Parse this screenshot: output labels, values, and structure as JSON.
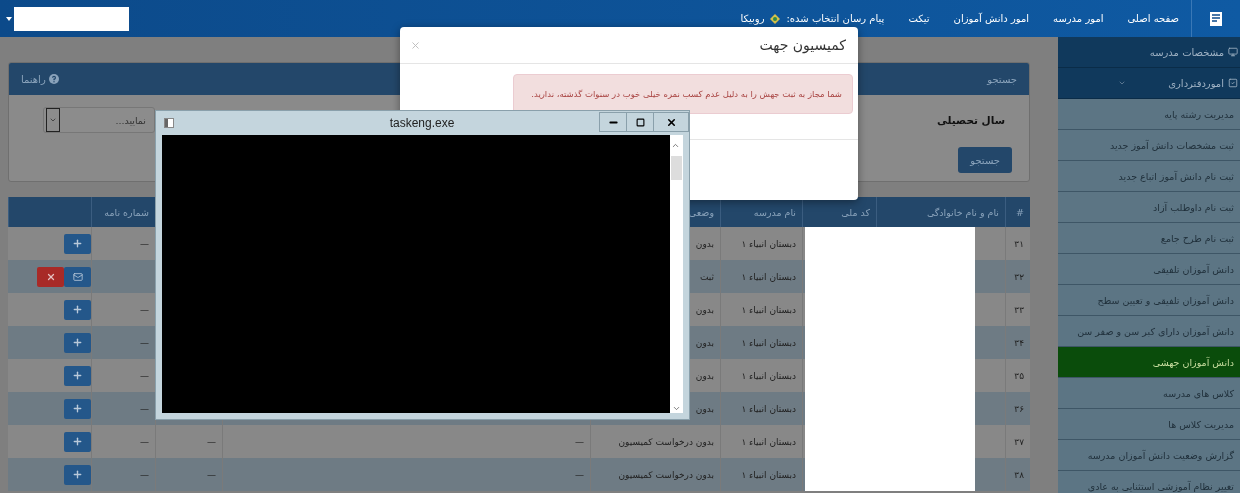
{
  "navbar": {
    "menu": [
      {
        "label": "صفحه اصلی"
      },
      {
        "label": "امور مدرسه"
      },
      {
        "label": "امور دانش آموزان"
      },
      {
        "label": "تیکت"
      }
    ],
    "messenger_label": "پیام رسان انتخاب شده:",
    "messenger_name": "روبیکا"
  },
  "sidebar": {
    "sections": [
      {
        "label": "مشخصات مدرسه",
        "expanded": false
      },
      {
        "label": "اموردفترداری",
        "expanded": true,
        "children": [
          {
            "label": "مدیریت رشته پایه",
            "selected": false
          },
          {
            "label": "ثبت مشخصات دانش آموز جدید",
            "selected": false
          },
          {
            "label": "ثبت نام دانش آموز اتباع جدید",
            "selected": false
          },
          {
            "label": "ثبت نام داوطلب آزاد",
            "selected": false
          },
          {
            "label": "ثبت نام طرح جامع",
            "selected": false
          },
          {
            "label": "دانش آموزان تلفیقی",
            "selected": false
          },
          {
            "label": "دانش آموزان تلفیقی و تعیین سطح",
            "selected": false
          },
          {
            "label": "دانش آموزان دارای کبر سن و صفر سن",
            "selected": false
          },
          {
            "label": "دانش آموزان جهشی",
            "selected": true
          },
          {
            "label": "کلاس های مدرسه",
            "selected": false
          },
          {
            "label": "مدیریت کلاس ها",
            "selected": false
          },
          {
            "label": "گزارش وضعیت دانش آموزان مدرسه",
            "selected": false
          },
          {
            "label": "تغییر نظام آموزشی استثنایی به عادی",
            "selected": false
          }
        ]
      }
    ]
  },
  "search_panel": {
    "title": "جستجو",
    "help": "راهنما",
    "year_label": "سال تحصیلی",
    "year_select": "نمایید...",
    "button": "جستجو"
  },
  "table": {
    "columns": {
      "number": "#",
      "name": "نام و نام خانوادگی",
      "national_code": "کد ملی",
      "school": "نام مدرسه",
      "status": "وضعی",
      "letter_number": "شماره نامه"
    },
    "rows": [
      {
        "number": "۳۱",
        "school": "دبستان انبیاء ۱",
        "status": "بدون",
        "letter_number": "—",
        "kind": "add"
      },
      {
        "number": "۳۲",
        "school": "دبستان انبیاء ۱",
        "status": "ثبت",
        "kind": "cancel_mail"
      },
      {
        "number": "۳۳",
        "school": "دبستان انبیاء ۱",
        "status": "بدون",
        "letter_number": "—",
        "kind": "add"
      },
      {
        "number": "۳۴",
        "school": "دبستان انبیاء ۱",
        "status": "بدون",
        "letter_number": "—",
        "kind": "add"
      },
      {
        "number": "۳۵",
        "school": "دبستان انبیاء ۱",
        "status": "بدون",
        "letter_number": "—",
        "kind": "add"
      },
      {
        "number": "۳۶",
        "school": "دبستان انبیاء ۱",
        "status": "بدون",
        "letter_number": "—",
        "kind": "add"
      },
      {
        "number": "۳۷",
        "school": "دبستان انبیاء ۱",
        "status": "بدون درخواست کمیسیون",
        "column_6": "—",
        "column_7": "—",
        "letter_number": "—",
        "kind": "add"
      },
      {
        "number": "۳۸",
        "school": "دبستان انبیاء ۱",
        "status": "بدون درخواست کمیسیون",
        "column_6": "—",
        "column_7": "—",
        "letter_number": "—",
        "kind": "add"
      }
    ]
  },
  "modal": {
    "title": "کمیسیون جهت",
    "alert": "شما مجاز به ثبت جهش را به دلیل عدم کسب نمره خیلی خوب در سنوات گذشته، ندارید."
  },
  "console_window": {
    "title": "taskeng.exe"
  }
}
